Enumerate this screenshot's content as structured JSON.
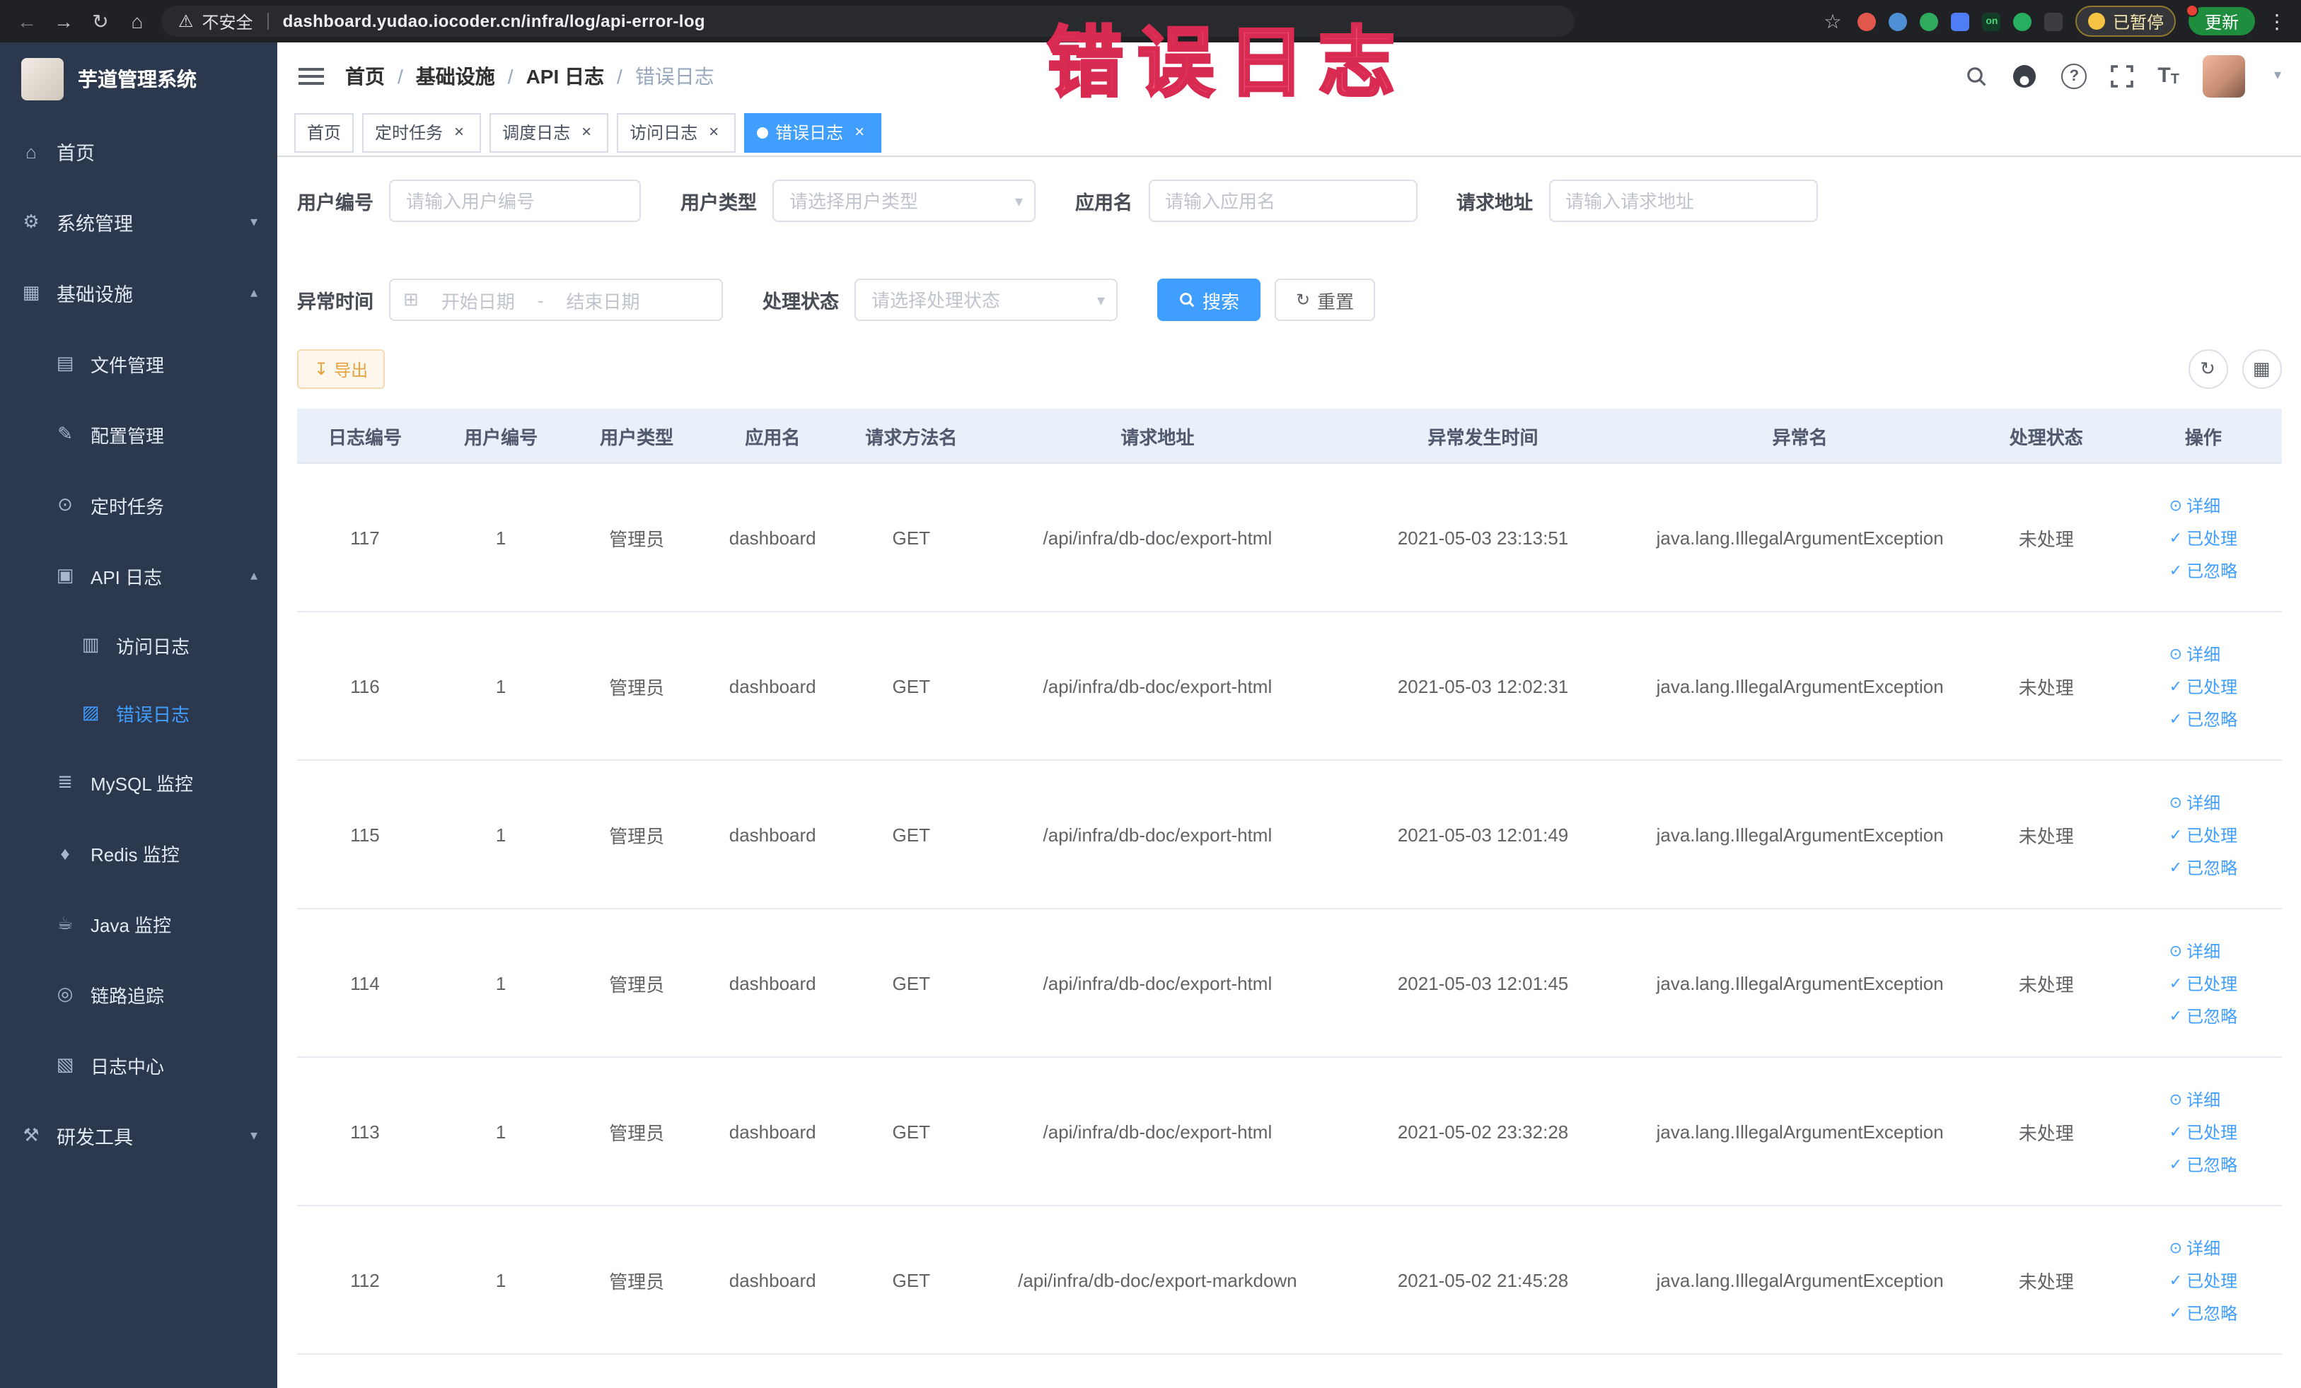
{
  "colors": {
    "accent_blue": "#409EFF",
    "warning_orange": "#E6A23C",
    "sidebar_bg": "#2B384E",
    "chrome_bg": "#202124",
    "table_header_bg": "#E9F0FA",
    "annotation_red": "#EF5D78",
    "update_green": "#1E8E3E"
  },
  "annotation": {
    "text": "错误日志"
  },
  "browser": {
    "warning_label": "不安全",
    "url": "dashboard.yudao.iocoder.cn/infra/log/api-error-log",
    "extension_on_badge": "on",
    "paused_label": "已暂停",
    "update_label": "更新"
  },
  "icons": {
    "back": "←",
    "forward": "→",
    "reload": "↻",
    "home_nav": "⌂",
    "warning": "⚠",
    "star": "☆",
    "kebab": "⋮",
    "menu_home": "⌂",
    "menu_system": "⚙",
    "menu_infra": "▦",
    "menu_file": "▤",
    "menu_config": "✎",
    "menu_job": "⊙",
    "menu_api_log": "▣",
    "menu_access_log": "▥",
    "menu_error_log": "▨",
    "menu_mysql": "≣",
    "menu_redis": "♦",
    "menu_java": "☕",
    "menu_trace": "◎",
    "menu_log_center": "▧",
    "menu_dev": "⚒",
    "arrow_down": "▾",
    "arrow_up": "▴",
    "close": "×",
    "select_caret": "▾",
    "calendar": "⊞",
    "reset": "↻",
    "download": "↧",
    "toolbar_refresh": "↻",
    "toolbar_grid": "▦",
    "eye": "⊙",
    "check": "✓",
    "question": "?",
    "text_size": "T",
    "user_caret": "▾"
  },
  "sidebar": {
    "logo_title": "芋道管理系统",
    "items": [
      {
        "label": "首页"
      },
      {
        "label": "系统管理"
      },
      {
        "label": "基础设施"
      },
      {
        "label": "文件管理"
      },
      {
        "label": "配置管理"
      },
      {
        "label": "定时任务"
      },
      {
        "label": "API 日志"
      },
      {
        "label": "访问日志"
      },
      {
        "label": "错误日志"
      },
      {
        "label": "MySQL 监控"
      },
      {
        "label": "Redis 监控"
      },
      {
        "label": "Java 监控"
      },
      {
        "label": "链路追踪"
      },
      {
        "label": "日志中心"
      },
      {
        "label": "研发工具"
      }
    ]
  },
  "breadcrumb": {
    "items": [
      "首页",
      "基础设施",
      "API 日志",
      "错误日志"
    ],
    "separator": "/"
  },
  "tabs": [
    {
      "label": "首页"
    },
    {
      "label": "定时任务"
    },
    {
      "label": "调度日志"
    },
    {
      "label": "访问日志"
    },
    {
      "label": "错误日志"
    }
  ],
  "filters": {
    "user_id_label": "用户编号",
    "user_id_placeholder": "请输入用户编号",
    "user_type_label": "用户类型",
    "user_type_placeholder": "请选择用户类型",
    "app_name_label": "应用名",
    "app_name_placeholder": "请输入应用名",
    "request_url_label": "请求地址",
    "request_url_placeholder": "请输入请求地址",
    "exception_time_label": "异常时间",
    "start_date_placeholder": "开始日期",
    "range_separator": "-",
    "end_date_placeholder": "结束日期",
    "process_status_label": "处理状态",
    "process_status_placeholder": "请选择处理状态",
    "search_label": "搜索",
    "reset_label": "重置"
  },
  "toolbar": {
    "export_label": "导出"
  },
  "table": {
    "columns": [
      "日志编号",
      "用户编号",
      "用户类型",
      "应用名",
      "请求方法名",
      "请求地址",
      "异常发生时间",
      "异常名",
      "处理状态",
      "操作"
    ],
    "action_labels": {
      "detail": "详细",
      "processed": "已处理",
      "ignored": "已忽略"
    },
    "rows": [
      {
        "id": "117",
        "user_id": "1",
        "user_type": "管理员",
        "app": "dashboard",
        "method": "GET",
        "url": "/api/infra/db-doc/export-html",
        "time": "2021-05-03 23:13:51",
        "exception": "java.lang.IllegalArgumentException",
        "status": "未处理"
      },
      {
        "id": "116",
        "user_id": "1",
        "user_type": "管理员",
        "app": "dashboard",
        "method": "GET",
        "url": "/api/infra/db-doc/export-html",
        "time": "2021-05-03 12:02:31",
        "exception": "java.lang.IllegalArgumentException",
        "status": "未处理"
      },
      {
        "id": "115",
        "user_id": "1",
        "user_type": "管理员",
        "app": "dashboard",
        "method": "GET",
        "url": "/api/infra/db-doc/export-html",
        "time": "2021-05-03 12:01:49",
        "exception": "java.lang.IllegalArgumentException",
        "status": "未处理"
      },
      {
        "id": "114",
        "user_id": "1",
        "user_type": "管理员",
        "app": "dashboard",
        "method": "GET",
        "url": "/api/infra/db-doc/export-html",
        "time": "2021-05-03 12:01:45",
        "exception": "java.lang.IllegalArgumentException",
        "status": "未处理"
      },
      {
        "id": "113",
        "user_id": "1",
        "user_type": "管理员",
        "app": "dashboard",
        "method": "GET",
        "url": "/api/infra/db-doc/export-html",
        "time": "2021-05-02 23:32:28",
        "exception": "java.lang.IllegalArgumentException",
        "status": "未处理"
      },
      {
        "id": "112",
        "user_id": "1",
        "user_type": "管理员",
        "app": "dashboard",
        "method": "GET",
        "url": "/api/infra/db-doc/export-markdown",
        "time": "2021-05-02 21:45:28",
        "exception": "java.lang.IllegalArgumentException",
        "status": "未处理"
      }
    ]
  }
}
